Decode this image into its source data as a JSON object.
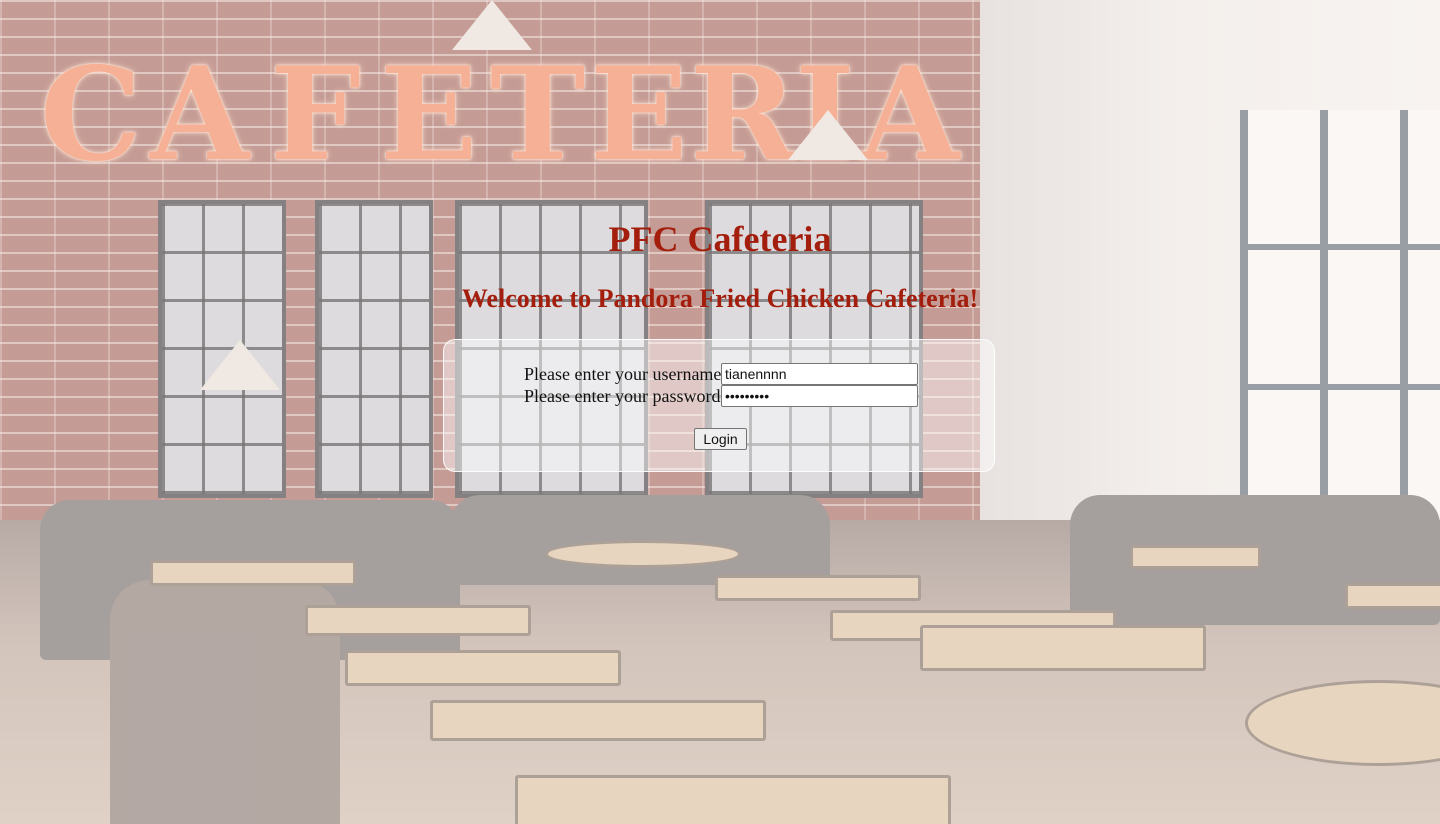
{
  "page": {
    "title": "PFC Cafeteria",
    "welcome": "Welcome to Pandora Fried Chicken Cafeteria!"
  },
  "login_form": {
    "username_label": "Please enter your username",
    "username_value": "tianennnn",
    "password_label": "Please enter your password",
    "password_value": "•••••••••",
    "submit_label": "Login"
  },
  "background": {
    "sign_letters": [
      "C",
      "A",
      "F",
      "E",
      "T",
      "E",
      "R",
      "I",
      "A"
    ],
    "colors": {
      "heading": "#a31e0c",
      "sign": "#f0875f"
    }
  }
}
